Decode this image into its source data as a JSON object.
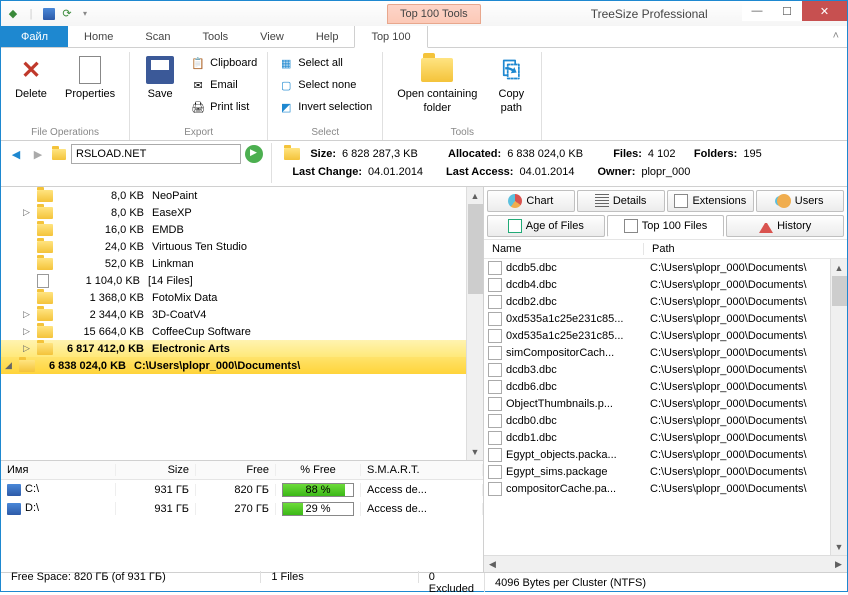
{
  "title_tab": "Top 100 Tools",
  "app_title": "TreeSize Professional",
  "menu": {
    "file": "Файл",
    "home": "Home",
    "scan": "Scan",
    "tools": "Tools",
    "view": "View",
    "help": "Help",
    "top100": "Top 100"
  },
  "ribbon": {
    "delete": "Delete",
    "properties": "Properties",
    "save": "Save",
    "clipboard": "Clipboard",
    "email": "Email",
    "printlist": "Print list",
    "selectall": "Select all",
    "selectnone": "Select none",
    "invert": "Invert selection",
    "openfolder_l1": "Open containing",
    "openfolder_l2": "folder",
    "copypath_l1": "Copy",
    "copypath_l2": "path",
    "group_fileops": "File Operations",
    "group_export": "Export",
    "group_select": "Select",
    "group_tools": "Tools"
  },
  "address": "RSLOAD.NET",
  "info": {
    "size_l": "Size:",
    "size_v": "6 828 287,3 KB",
    "alloc_l": "Allocated:",
    "alloc_v": "6 838 024,0 KB",
    "files_l": "Files:",
    "files_v": "4 102",
    "folders_l": "Folders:",
    "folders_v": "195",
    "lastchange_l": "Last Change:",
    "lastchange_v": "04.01.2014",
    "lastaccess_l": "Last Access:",
    "lastaccess_v": "04.01.2014",
    "owner_l": "Owner:",
    "owner_v": "plopr_000"
  },
  "tree": [
    {
      "indent": 0,
      "arrow": "◢",
      "size": "6 838 024,0 KB",
      "name": "C:\\Users\\plopr_000\\Documents\\",
      "sel": 1,
      "folder": true
    },
    {
      "indent": 1,
      "arrow": "▷",
      "size": "6 817 412,0 KB",
      "name": "Electronic Arts",
      "sel": 2,
      "folder": true
    },
    {
      "indent": 1,
      "arrow": "▷",
      "size": "15 664,0 KB",
      "name": "CoffeeCup Software",
      "folder": true
    },
    {
      "indent": 1,
      "arrow": "▷",
      "size": "2 344,0 KB",
      "name": "3D-CoatV4",
      "folder": true
    },
    {
      "indent": 1,
      "arrow": "",
      "size": "1 368,0 KB",
      "name": "FotoMix Data",
      "folder": true
    },
    {
      "indent": 1,
      "arrow": "",
      "size": "1 104,0 KB",
      "name": "[14 Files]",
      "folder": false
    },
    {
      "indent": 1,
      "arrow": "",
      "size": "52,0 KB",
      "name": "Linkman",
      "folder": true
    },
    {
      "indent": 1,
      "arrow": "",
      "size": "24,0 KB",
      "name": "Virtuous Ten Studio",
      "folder": true
    },
    {
      "indent": 1,
      "arrow": "",
      "size": "16,0 KB",
      "name": "EMDB",
      "folder": true
    },
    {
      "indent": 1,
      "arrow": "▷",
      "size": "8,0 KB",
      "name": "EaseXP",
      "folder": true
    },
    {
      "indent": 1,
      "arrow": "",
      "size": "8,0 KB",
      "name": "NeoPaint",
      "folder": true
    }
  ],
  "drives_hdr": {
    "name": "Имя",
    "size": "Size",
    "free": "Free",
    "pct": "% Free",
    "smart": "S.M.A.R.T."
  },
  "drives": [
    {
      "icon": "disk",
      "name": "C:\\",
      "size": "931 ГБ",
      "free": "820 ГБ",
      "pct": "88 %",
      "pctw": 88,
      "smart": "Access de..."
    },
    {
      "icon": "cd",
      "name": "D:\\",
      "size": "931 ГБ",
      "free": "270 ГБ",
      "pct": "29 %",
      "pctw": 29,
      "smart": "Access de..."
    }
  ],
  "tabs": {
    "chart": "Chart",
    "details": "Details",
    "ext": "Extensions",
    "users": "Users",
    "age": "Age of Files",
    "top100": "Top 100 Files",
    "history": "History"
  },
  "flist_hdr": {
    "name": "Name",
    "path": "Path"
  },
  "files": [
    {
      "name": "dcdb5.dbc",
      "path": "C:\\Users\\plopr_000\\Documents\\"
    },
    {
      "name": "dcdb4.dbc",
      "path": "C:\\Users\\plopr_000\\Documents\\"
    },
    {
      "name": "dcdb2.dbc",
      "path": "C:\\Users\\plopr_000\\Documents\\"
    },
    {
      "name": "0xd535a1c25e231c85...",
      "path": "C:\\Users\\plopr_000\\Documents\\"
    },
    {
      "name": "0xd535a1c25e231c85...",
      "path": "C:\\Users\\plopr_000\\Documents\\"
    },
    {
      "name": "simCompositorCach...",
      "path": "C:\\Users\\plopr_000\\Documents\\"
    },
    {
      "name": "dcdb3.dbc",
      "path": "C:\\Users\\plopr_000\\Documents\\"
    },
    {
      "name": "dcdb6.dbc",
      "path": "C:\\Users\\plopr_000\\Documents\\"
    },
    {
      "name": "ObjectThumbnails.p...",
      "path": "C:\\Users\\plopr_000\\Documents\\"
    },
    {
      "name": "dcdb0.dbc",
      "path": "C:\\Users\\plopr_000\\Documents\\"
    },
    {
      "name": "dcdb1.dbc",
      "path": "C:\\Users\\plopr_000\\Documents\\"
    },
    {
      "name": "Egypt_objects.packa...",
      "path": "C:\\Users\\plopr_000\\Documents\\"
    },
    {
      "name": "Egypt_sims.package",
      "path": "C:\\Users\\plopr_000\\Documents\\"
    },
    {
      "name": "compositorCache.pa...",
      "path": "C:\\Users\\plopr_000\\Documents\\"
    }
  ],
  "status": {
    "free": "Free Space: 820 ГБ  (of 931 ГБ)",
    "files": "1  Files",
    "excluded": "0 Excluded",
    "cluster": "4096 Bytes per Cluster (NTFS)"
  }
}
